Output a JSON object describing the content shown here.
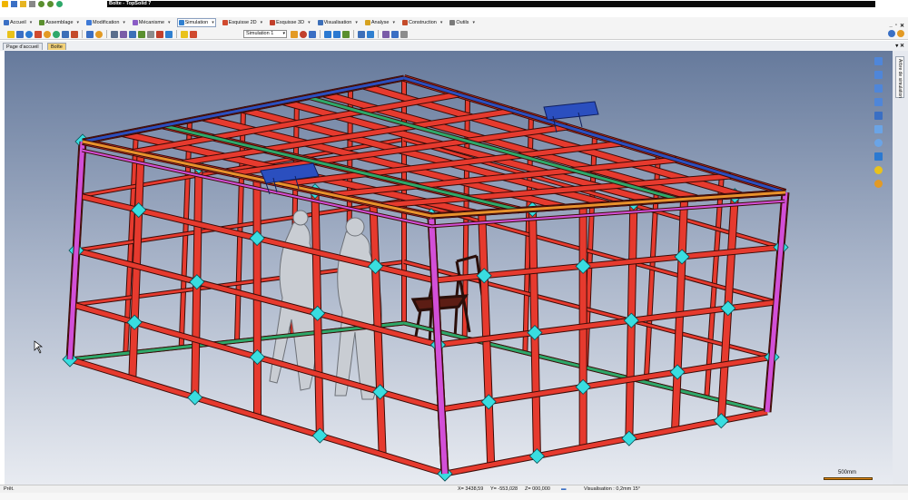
{
  "window": {
    "doc_name": "Boîte",
    "title": "Boîte - TopSolid 7"
  },
  "menu": [
    {
      "label": "Accueil",
      "icon": "home-icon",
      "color": "#3a6fc4"
    },
    {
      "label": "Assemblage",
      "icon": "assembly-icon",
      "color": "#5a8f2f"
    },
    {
      "label": "Modification",
      "icon": "modification-icon",
      "color": "#3f7ad6"
    },
    {
      "label": "Mécanisme",
      "icon": "mechanism-icon",
      "color": "#8b5cc6"
    },
    {
      "label": "Simulation",
      "icon": "simulation-icon",
      "color": "#2f7fd0",
      "active": true
    },
    {
      "label": "Esquisse 2D",
      "icon": "sketch-2d-icon",
      "color": "#d04a2f"
    },
    {
      "label": "Esquisse 3D",
      "icon": "sketch-3d-icon",
      "color": "#c2402c"
    },
    {
      "label": "Visualisation",
      "icon": "visualisation-icon",
      "color": "#3d6fb8"
    },
    {
      "label": "Analyse",
      "icon": "analysis-icon",
      "color": "#d6a21f"
    },
    {
      "label": "Construction",
      "icon": "construction-icon",
      "color": "#c44b2a"
    },
    {
      "label": "Outils",
      "icon": "tools-icon",
      "color": "#7a7a7a"
    }
  ],
  "toolbar": {
    "simulation_select": "Simulation 1"
  },
  "tabs": {
    "home": "Page d'accueil",
    "document": "Boîte"
  },
  "side_panel": {
    "label": "Arbre de simulation"
  },
  "scale": {
    "label": "500mm"
  },
  "status": {
    "state": "Prêt.",
    "x": "X= 3438,59",
    "y": "Y= -553,028",
    "z": "Z= 000,000",
    "visualisation": "Visualisation : 0,2mm 15°"
  },
  "colors": {
    "frame_red": "#e63a2e",
    "node_cyan": "#39dde0",
    "edge_magenta": "#d24fd8",
    "rail_orange": "#e8922c",
    "rail_blue": "#2b4fbf",
    "rail_green": "#2ea86a",
    "viewport_top": "#667a9c",
    "viewport_bottom": "#e8ebf1"
  }
}
